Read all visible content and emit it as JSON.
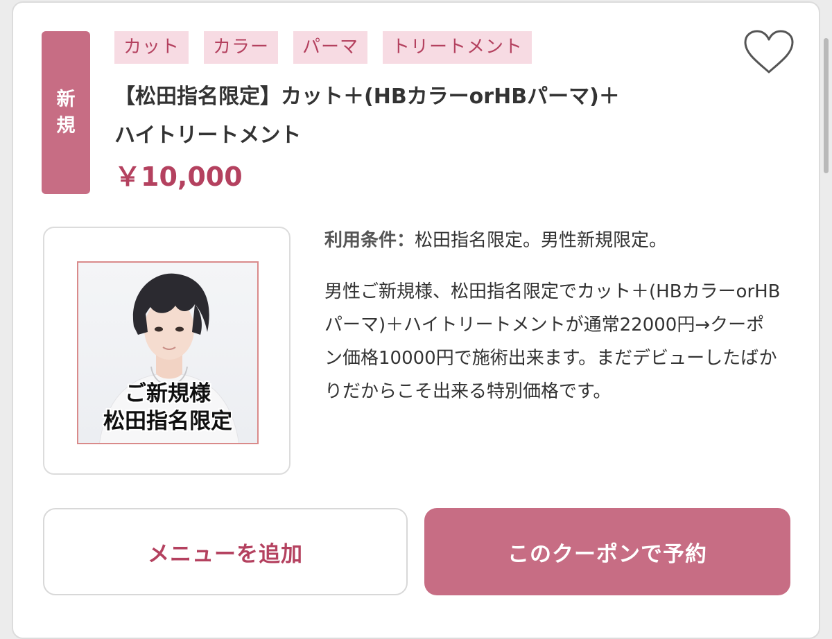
{
  "badge": {
    "new_label": "新規"
  },
  "tags": [
    "カット",
    "カラー",
    "パーマ",
    "トリートメント"
  ],
  "coupon": {
    "title_line1": "【松田指名限定】カット＋(HBカラーorHBパーマ)＋",
    "title_line2": "ハイトリートメント",
    "price": "￥10,000"
  },
  "image": {
    "caption_line1": "ご新規様",
    "caption_line2": "松田指名限定"
  },
  "conditions": {
    "label": "利用条件：",
    "text": "松田指名限定。男性新規限定。"
  },
  "description": "男性ご新規様、松田指名限定でカット＋(HBカラーorHBパーマ)＋ハイトリートメントが通常22000円→クーポン価格10000円で施術出来ます。まだデビューしたばかりだからこそ出来る特別価格です。",
  "buttons": {
    "add_menu": "メニューを追加",
    "reserve": "このクーポンで予約"
  },
  "colors": {
    "accent": "#c76d84",
    "accent_text": "#b4415f",
    "tag_bg": "#f7dbe3"
  },
  "icons": {
    "favorite": "heart-outline-icon"
  }
}
